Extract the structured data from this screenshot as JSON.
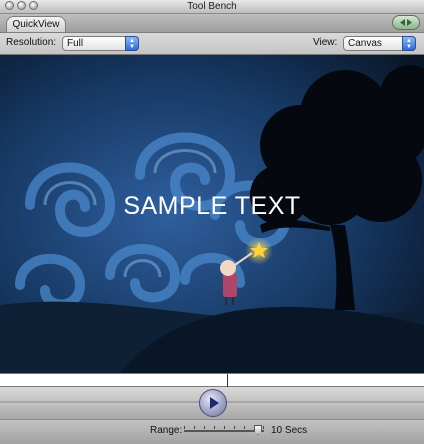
{
  "window": {
    "title": "Tool Bench"
  },
  "tabs": [
    {
      "label": "QuickView"
    }
  ],
  "toolbar": {
    "resolution_label": "Resolution:",
    "resolution_value": "Full",
    "view_label": "View:",
    "view_value": "Canvas"
  },
  "canvas": {
    "overlay_text": "SAMPLE TEXT"
  },
  "transport": {
    "play_icon": "play-icon"
  },
  "footer": {
    "range_label": "Range:",
    "duration": "10 Secs"
  },
  "colors": {
    "sky_dark": "#0b1a30",
    "swirl": "#3b7bc1",
    "accent_blue": "#2f6cd6",
    "star": "#ffd23a"
  }
}
